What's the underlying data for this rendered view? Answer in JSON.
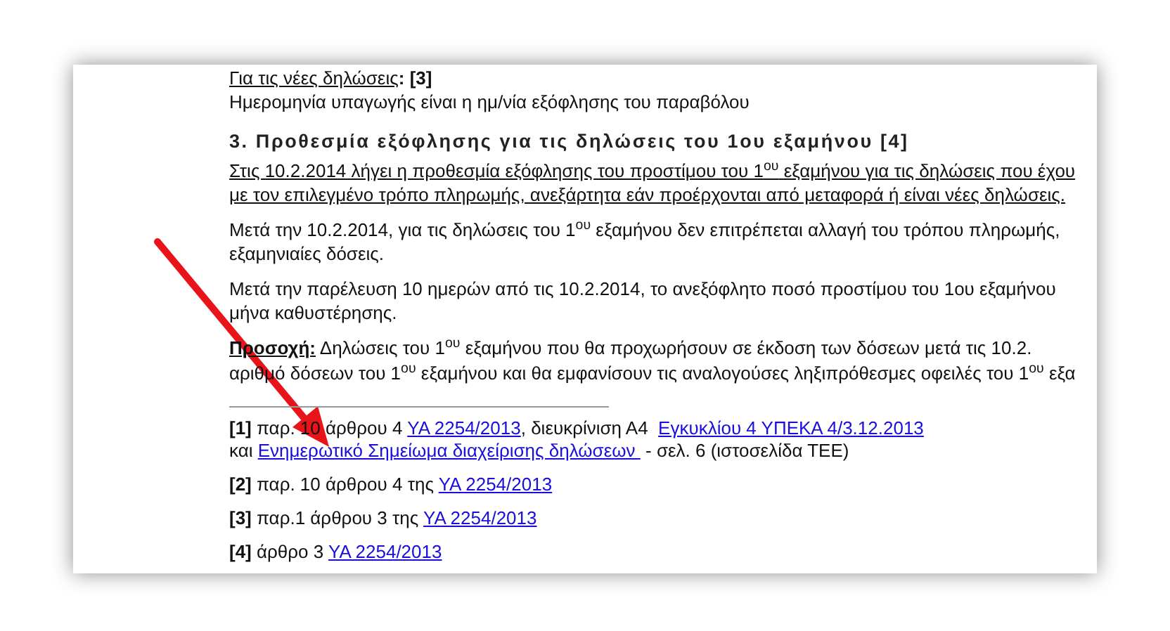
{
  "document": {
    "blocks": [
      {
        "kind": "cut",
        "text": "Για τις νέες δηλώσεις",
        "tail": ": [3]"
      },
      {
        "kind": "plain",
        "lines": [
          "Ημερομηνία υπαγωγής είναι η ημ/νία εξόφλησης του παραβόλου"
        ]
      },
      {
        "kind": "heading",
        "lines": [
          "3. Προθεσμία εξόφλησης για τις δηλώσεις του 1ου εξαμήνου [4]"
        ]
      },
      {
        "kind": "underlined",
        "lines": [
          "Στις 10.2.2014 λήγει η προθεσμία εξόφλησης του προστίμου του 1$^{ου}$ εξαμήνου για τις δηλώσεις που έχου",
          "με τον επιλεγμένο τρόπο πληρωμής, ανεξάρτητα εάν προέρχονται από μεταφορά ή είναι νέες δηλώσεις."
        ]
      },
      {
        "kind": "plain",
        "lines": [
          "Μετά την 10.2.2014, για τις δηλώσεις του 1$^{ου}$ εξαμήνου δεν επιτρέπεται αλλαγή του τρόπου πληρωμής,",
          "εξαμηνιαίες δόσεις."
        ]
      },
      {
        "kind": "plain",
        "lines": [
          "Μετά την παρέλευση 10 ημερών από τις 10.2.2014, το ανεξόφλητο ποσό προστίμου του 1ου εξαμήνου",
          "μήνα καθυστέρησης."
        ]
      },
      {
        "kind": "note",
        "label": "Προσοχή:",
        "lines": [
          "Δηλώσεις του 1$^{ου}$ εξαμήνου που θα προχωρήσουν σε έκδοση των δόσεων μετά τις 10.2.",
          "αριθμό δόσεων του 1$^{ου}$ εξαμήνου και θα εμφανίσουν τις αναλογούσες ληξιπρόθεσμες οφειλές του 1$^{ου}$ εξα"
        ]
      }
    ]
  },
  "footnotes": [
    {
      "marker": "[1]",
      "lines": [
        [
          {
            "kind": "text",
            "text": "παρ. 10 άρθρου 4 "
          },
          {
            "kind": "link",
            "text": "ΥΑ 2254/2013"
          },
          {
            "kind": "text",
            "text": ", διευκρίνιση Α4  "
          },
          {
            "kind": "link",
            "text": "Εγκυκλίου 4 ΥΠΕΚΑ 4/3.12.2013"
          }
        ],
        [
          {
            "kind": "text",
            "text": "και "
          },
          {
            "kind": "link",
            "text": "Ενημερωτικό Σημείωμα διαχείρισης δηλώσεων "
          },
          {
            "kind": "text",
            "text": " - σελ. 6 (ιστοσελίδα ΤΕΕ)"
          }
        ]
      ]
    },
    {
      "marker": "[2]",
      "lines": [
        [
          {
            "kind": "text",
            "text": "παρ. 10 άρθρου 4 της "
          },
          {
            "kind": "link",
            "text": "ΥΑ 2254/2013"
          }
        ]
      ]
    },
    {
      "marker": "[3]",
      "lines": [
        [
          {
            "kind": "text",
            "text": "παρ.1 άρθρου 3 της "
          },
          {
            "kind": "link",
            "text": "ΥΑ 2254/2013"
          }
        ]
      ]
    },
    {
      "marker": "[4]",
      "lines": [
        [
          {
            "kind": "text",
            "text": "άρθρο 3 "
          },
          {
            "kind": "link",
            "text": "ΥΑ 2254/2013"
          }
        ]
      ]
    }
  ]
}
